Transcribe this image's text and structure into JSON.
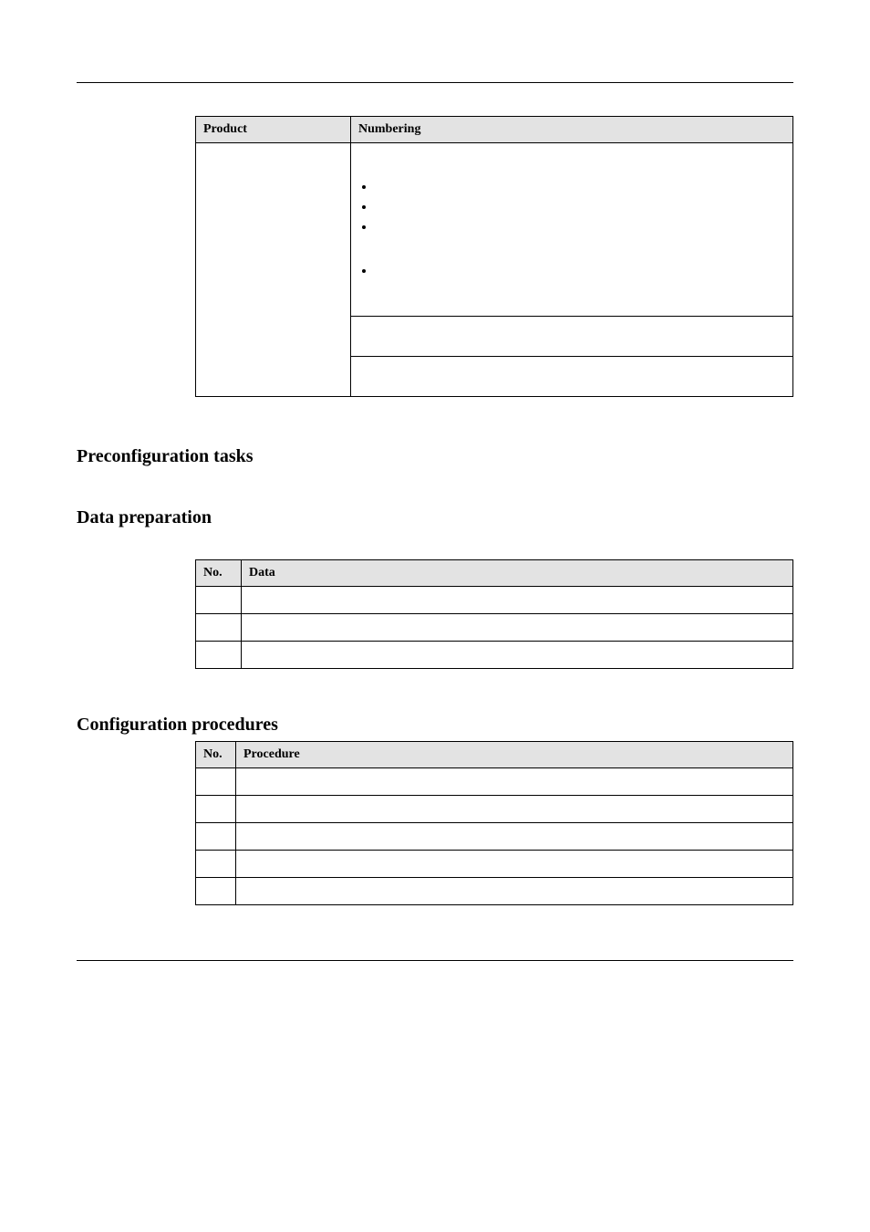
{
  "product_table": {
    "headers": {
      "product": "Product",
      "numbering": "Numbering"
    }
  },
  "sections": {
    "preconfig": "Preconfiguration tasks",
    "data_prep": "Data preparation",
    "config_proc": "Configuration procedures"
  },
  "data_table": {
    "headers": {
      "no": "No.",
      "data": "Data"
    },
    "rows": [
      {
        "no": "",
        "data": ""
      },
      {
        "no": "",
        "data": ""
      },
      {
        "no": "",
        "data": ""
      }
    ]
  },
  "proc_table": {
    "headers": {
      "no": "No.",
      "procedure": "Procedure"
    },
    "rows": [
      {
        "no": "",
        "procedure": ""
      },
      {
        "no": "",
        "procedure": ""
      },
      {
        "no": "",
        "procedure": ""
      },
      {
        "no": "",
        "procedure": ""
      },
      {
        "no": "",
        "procedure": ""
      }
    ]
  }
}
